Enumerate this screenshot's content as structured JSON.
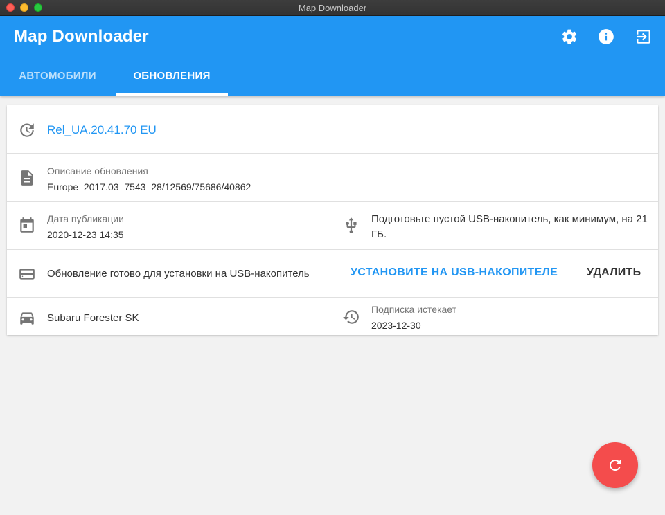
{
  "window": {
    "title": "Map Downloader"
  },
  "app": {
    "title": "Map Downloader",
    "header_icons": [
      "gear-icon",
      "info-icon",
      "exit-icon"
    ],
    "accent_color": "#2196f3",
    "fab_color": "#f44c4c"
  },
  "tabs": [
    {
      "label": "АВТОМОБИЛИ",
      "active": false
    },
    {
      "label": "ОБНОВЛЕНИЯ",
      "active": true
    }
  ],
  "update": {
    "release": "Rel_UA.20.41.70 EU",
    "description_label": "Описание обновления",
    "description_value": "Europe_2017.03_7543_28/12569/75686/40862",
    "published_label": "Дата публикации",
    "published_value": "2020-12-23 14:35",
    "usb_note": "Подготовьте пустой USB-накопитель, как минимум, на 21 ГБ.",
    "status": "Обновление готово для установки на USB-накопитель",
    "install_label": "УСТАНОВИТЕ НА USB-НАКОПИТЕЛЕ",
    "delete_label": "УДАЛИТЬ",
    "car": "Subaru Forester SK",
    "subscription_label": "Подписка истекает",
    "subscription_value": "2023-12-30"
  }
}
